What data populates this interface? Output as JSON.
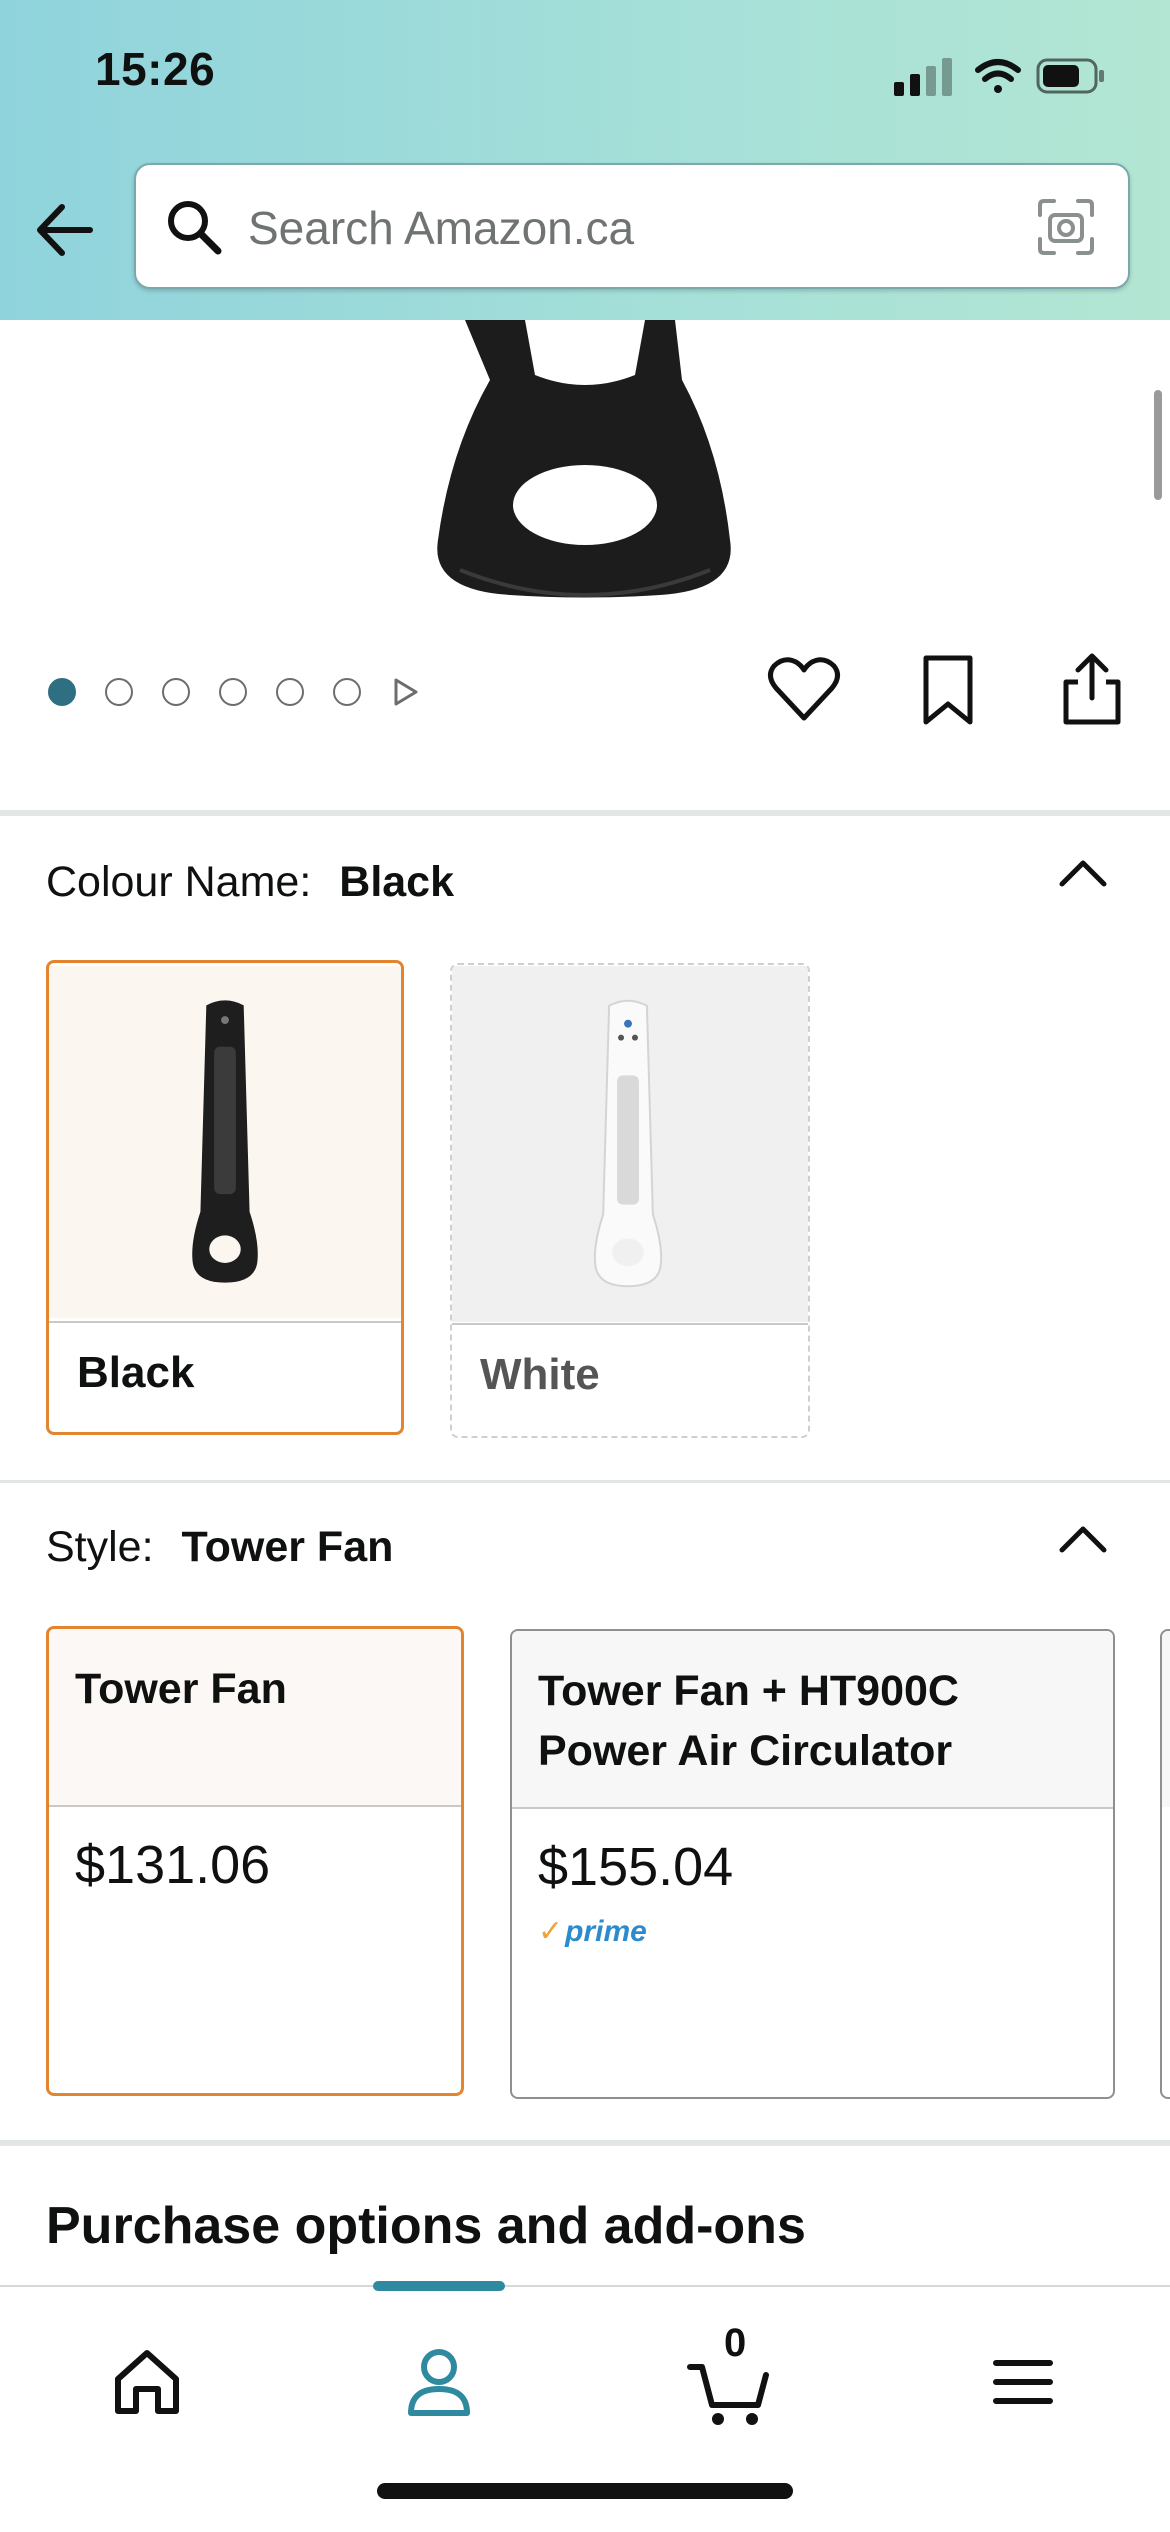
{
  "status_bar": {
    "time": "15:26"
  },
  "search": {
    "placeholder": "Search Amazon.ca"
  },
  "gallery": {
    "image_count": 6,
    "active_index": 0
  },
  "colour": {
    "label": "Colour Name:",
    "selected": "Black",
    "options": [
      {
        "label": "Black",
        "state": "selected"
      },
      {
        "label": "White",
        "state": "unavailable"
      }
    ]
  },
  "style": {
    "label": "Style:",
    "selected": "Tower Fan",
    "options": [
      {
        "title": "Tower Fan",
        "price": "$131.06",
        "prime": false,
        "state": "selected"
      },
      {
        "title": "Tower Fan + HT900C Power Air Circulator",
        "price": "$155.04",
        "prime": true,
        "prime_label": "prime",
        "state": "normal"
      }
    ]
  },
  "purchase_options": {
    "heading": "Purchase options and add-ons"
  },
  "bottom_nav": {
    "items": [
      "home-icon",
      "account-icon",
      "cart-icon",
      "menu-icon"
    ],
    "active": "account-icon",
    "cart_count": "0"
  },
  "colors": {
    "accent": "#e3852f",
    "nav_active": "#2f8aa0",
    "prime": "#2b8bcc"
  }
}
